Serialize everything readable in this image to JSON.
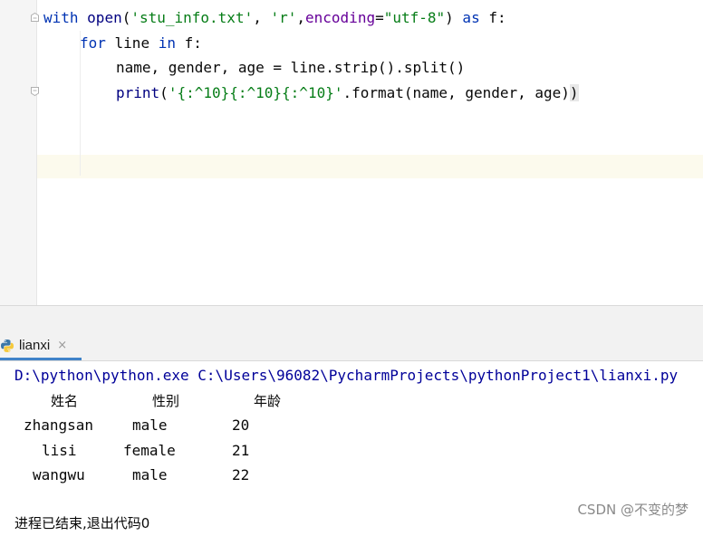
{
  "editor": {
    "line1": {
      "kw_with": "with",
      "fn_open": "open",
      "p1": "(",
      "str_file": "'stu_info.txt'",
      "comma1": ", ",
      "str_mode": "'r'",
      "comma2": ",",
      "param_encoding": "encoding",
      "eq": "=",
      "str_enc": "\"utf-8\"",
      "p2": ")",
      "kw_as": " as ",
      "var_f": "f:"
    },
    "line2": {
      "kw_for": "for",
      "rest1": " line ",
      "kw_in": "in",
      "rest2": " f:"
    },
    "line3": {
      "text": "name, gender, age = line.strip().split()"
    },
    "line4": {
      "fn_print": "print",
      "p1": "(",
      "str_fmt": "'{:^10}{:^10}{:^10}'",
      "rest": ".format(name, gender, age)",
      "p2": ")"
    }
  },
  "run_panel": {
    "tab_label": "lianxi",
    "close_glyph": "×",
    "icon": "python-icon"
  },
  "console": {
    "command": "D:\\python\\python.exe C:\\Users\\96082\\PycharmProjects\\pythonProject1\\lianxi.py",
    "headers": [
      "姓名",
      "性别",
      "年龄"
    ],
    "rows": [
      [
        "zhangsan",
        "male",
        "20"
      ],
      [
        "lisi",
        "female",
        "21"
      ],
      [
        "wangwu",
        "male",
        "22"
      ]
    ],
    "exit_message": "进程已结束,退出代码0"
  },
  "watermark": "CSDN @不变的梦"
}
